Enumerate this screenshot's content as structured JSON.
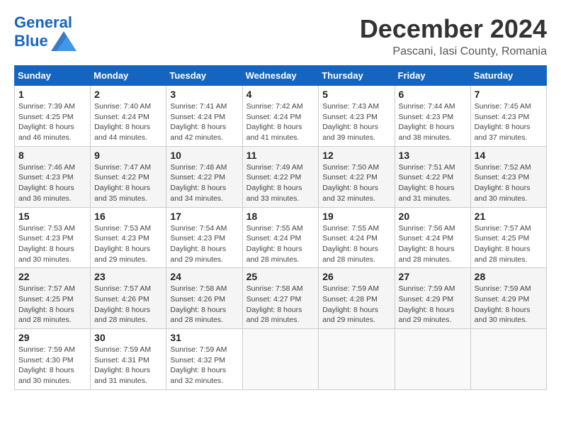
{
  "header": {
    "logo_line1": "General",
    "logo_line2": "Blue",
    "month": "December 2024",
    "location": "Pascani, Iasi County, Romania"
  },
  "weekdays": [
    "Sunday",
    "Monday",
    "Tuesday",
    "Wednesday",
    "Thursday",
    "Friday",
    "Saturday"
  ],
  "weeks": [
    [
      {
        "day": "1",
        "sunrise": "7:39 AM",
        "sunset": "4:25 PM",
        "daylight": "8 hours and 46 minutes."
      },
      {
        "day": "2",
        "sunrise": "7:40 AM",
        "sunset": "4:24 PM",
        "daylight": "8 hours and 44 minutes."
      },
      {
        "day": "3",
        "sunrise": "7:41 AM",
        "sunset": "4:24 PM",
        "daylight": "8 hours and 42 minutes."
      },
      {
        "day": "4",
        "sunrise": "7:42 AM",
        "sunset": "4:24 PM",
        "daylight": "8 hours and 41 minutes."
      },
      {
        "day": "5",
        "sunrise": "7:43 AM",
        "sunset": "4:23 PM",
        "daylight": "8 hours and 39 minutes."
      },
      {
        "day": "6",
        "sunrise": "7:44 AM",
        "sunset": "4:23 PM",
        "daylight": "8 hours and 38 minutes."
      },
      {
        "day": "7",
        "sunrise": "7:45 AM",
        "sunset": "4:23 PM",
        "daylight": "8 hours and 37 minutes."
      }
    ],
    [
      {
        "day": "8",
        "sunrise": "7:46 AM",
        "sunset": "4:23 PM",
        "daylight": "8 hours and 36 minutes."
      },
      {
        "day": "9",
        "sunrise": "7:47 AM",
        "sunset": "4:22 PM",
        "daylight": "8 hours and 35 minutes."
      },
      {
        "day": "10",
        "sunrise": "7:48 AM",
        "sunset": "4:22 PM",
        "daylight": "8 hours and 34 minutes."
      },
      {
        "day": "11",
        "sunrise": "7:49 AM",
        "sunset": "4:22 PM",
        "daylight": "8 hours and 33 minutes."
      },
      {
        "day": "12",
        "sunrise": "7:50 AM",
        "sunset": "4:22 PM",
        "daylight": "8 hours and 32 minutes."
      },
      {
        "day": "13",
        "sunrise": "7:51 AM",
        "sunset": "4:22 PM",
        "daylight": "8 hours and 31 minutes."
      },
      {
        "day": "14",
        "sunrise": "7:52 AM",
        "sunset": "4:23 PM",
        "daylight": "8 hours and 30 minutes."
      }
    ],
    [
      {
        "day": "15",
        "sunrise": "7:53 AM",
        "sunset": "4:23 PM",
        "daylight": "8 hours and 30 minutes."
      },
      {
        "day": "16",
        "sunrise": "7:53 AM",
        "sunset": "4:23 PM",
        "daylight": "8 hours and 29 minutes."
      },
      {
        "day": "17",
        "sunrise": "7:54 AM",
        "sunset": "4:23 PM",
        "daylight": "8 hours and 29 minutes."
      },
      {
        "day": "18",
        "sunrise": "7:55 AM",
        "sunset": "4:24 PM",
        "daylight": "8 hours and 28 minutes."
      },
      {
        "day": "19",
        "sunrise": "7:55 AM",
        "sunset": "4:24 PM",
        "daylight": "8 hours and 28 minutes."
      },
      {
        "day": "20",
        "sunrise": "7:56 AM",
        "sunset": "4:24 PM",
        "daylight": "8 hours and 28 minutes."
      },
      {
        "day": "21",
        "sunrise": "7:57 AM",
        "sunset": "4:25 PM",
        "daylight": "8 hours and 28 minutes."
      }
    ],
    [
      {
        "day": "22",
        "sunrise": "7:57 AM",
        "sunset": "4:25 PM",
        "daylight": "8 hours and 28 minutes."
      },
      {
        "day": "23",
        "sunrise": "7:57 AM",
        "sunset": "4:26 PM",
        "daylight": "8 hours and 28 minutes."
      },
      {
        "day": "24",
        "sunrise": "7:58 AM",
        "sunset": "4:26 PM",
        "daylight": "8 hours and 28 minutes."
      },
      {
        "day": "25",
        "sunrise": "7:58 AM",
        "sunset": "4:27 PM",
        "daylight": "8 hours and 28 minutes."
      },
      {
        "day": "26",
        "sunrise": "7:59 AM",
        "sunset": "4:28 PM",
        "daylight": "8 hours and 29 minutes."
      },
      {
        "day": "27",
        "sunrise": "7:59 AM",
        "sunset": "4:29 PM",
        "daylight": "8 hours and 29 minutes."
      },
      {
        "day": "28",
        "sunrise": "7:59 AM",
        "sunset": "4:29 PM",
        "daylight": "8 hours and 30 minutes."
      }
    ],
    [
      {
        "day": "29",
        "sunrise": "7:59 AM",
        "sunset": "4:30 PM",
        "daylight": "8 hours and 30 minutes."
      },
      {
        "day": "30",
        "sunrise": "7:59 AM",
        "sunset": "4:31 PM",
        "daylight": "8 hours and 31 minutes."
      },
      {
        "day": "31",
        "sunrise": "7:59 AM",
        "sunset": "4:32 PM",
        "daylight": "8 hours and 32 minutes."
      },
      null,
      null,
      null,
      null
    ]
  ]
}
